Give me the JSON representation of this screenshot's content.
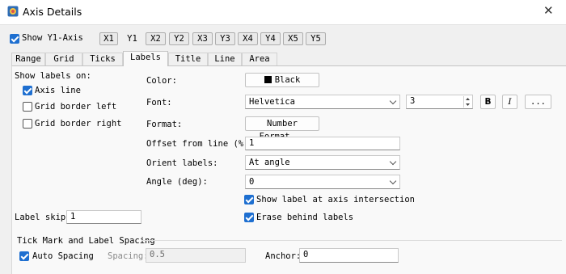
{
  "window": {
    "title": "Axis Details",
    "close_icon": "close-icon"
  },
  "show_axis": {
    "label": "Show Y1-Axis",
    "checked": true
  },
  "axis_buttons": [
    "X1",
    "Y1",
    "X2",
    "Y2",
    "X3",
    "Y3",
    "X4",
    "Y4",
    "X5",
    "Y5"
  ],
  "selected_axis": "Y1",
  "tabs": [
    "Range",
    "Grid",
    "Ticks",
    "Labels",
    "Title",
    "Line",
    "Area"
  ],
  "active_tab": "Labels",
  "show_labels": {
    "heading": "Show labels on:",
    "axis_line": "Axis line",
    "grid_border_left": "Grid border left",
    "grid_border_right": "Grid border right"
  },
  "label_skip": {
    "label": "Label skip:",
    "value": "1"
  },
  "color": {
    "label": "Color:",
    "value": "Black",
    "swatch": "#000000"
  },
  "font": {
    "label": "Font:",
    "family": "Helvetica",
    "size": "3",
    "bold": "B",
    "italic": "I",
    "more": "..."
  },
  "format": {
    "label": "Format:",
    "button": "Number Format..."
  },
  "offset": {
    "label": "Offset from line (%):",
    "value": "1"
  },
  "orient": {
    "label": "Orient labels:",
    "value": "At angle"
  },
  "angle": {
    "label": "Angle (deg):",
    "value": "0"
  },
  "show_intersection": {
    "label": "Show label at axis intersection",
    "checked": true
  },
  "erase_behind": {
    "label": "Erase behind labels",
    "checked": true
  },
  "tick_section": {
    "heading": "Tick Mark and Label Spacing",
    "auto_spacing": "Auto Spacing",
    "spacing_label": "Spacing:",
    "spacing_value": "0.5",
    "anchor_label": "Anchor:",
    "anchor_value": "0"
  },
  "colors": {
    "accent": "#1e6fd0"
  }
}
